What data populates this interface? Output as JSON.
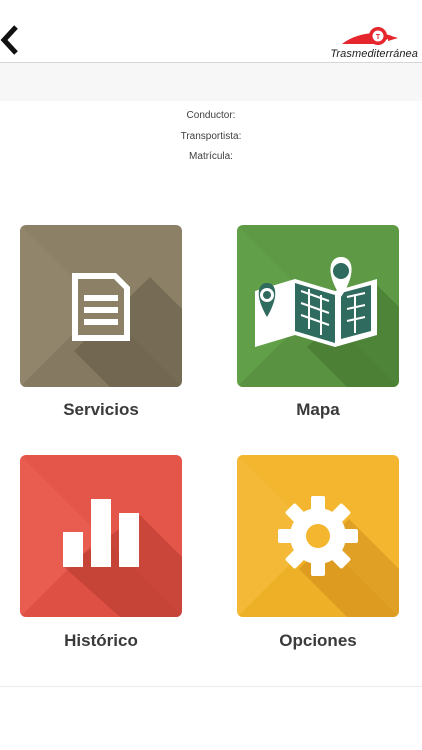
{
  "header": {
    "back_icon": "chevron-left-icon",
    "logo_text": "Trasmediterránea",
    "logo_icon": "trasmediterranea-logo-icon",
    "colors": {
      "logo_red": "#e5262c"
    }
  },
  "driver_info": {
    "conductor_label": "Conductor:",
    "transportista_label": "Transportista:",
    "matricula_label": "Matrícula:"
  },
  "menu": [
    {
      "label": "Servicios",
      "icon": "document-icon",
      "color": "#8c8067"
    },
    {
      "label": "Mapa",
      "icon": "map-icon",
      "color": "#5e9a45"
    },
    {
      "label": "Histórico",
      "icon": "bar-chart-icon",
      "color": "#e5564a"
    },
    {
      "label": "Opciones",
      "icon": "gear-icon",
      "color": "#f3b62e"
    }
  ]
}
